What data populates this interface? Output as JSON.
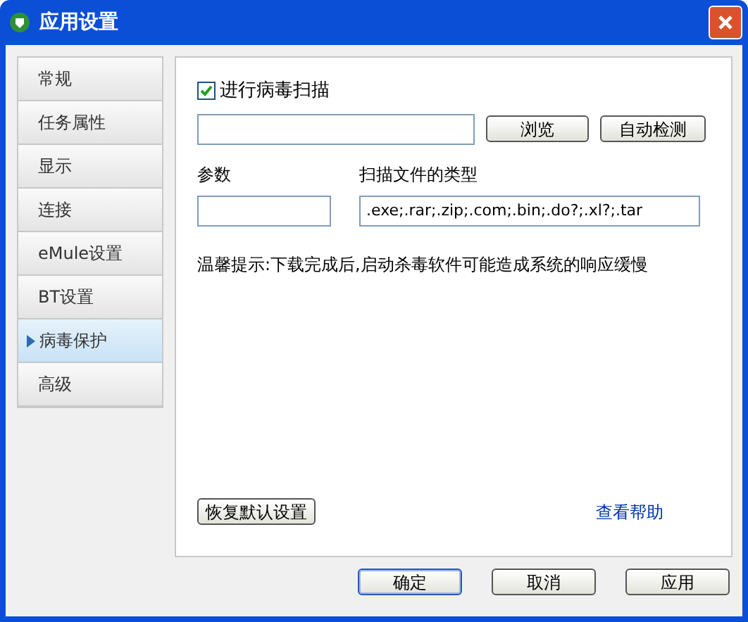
{
  "window": {
    "title": "应用设置"
  },
  "sidebar": {
    "items": [
      {
        "label": "常规",
        "selected": false
      },
      {
        "label": "任务属性",
        "selected": false
      },
      {
        "label": "显示",
        "selected": false
      },
      {
        "label": "连接",
        "selected": false
      },
      {
        "label": "eMule设置",
        "selected": false
      },
      {
        "label": "BT设置",
        "selected": false
      },
      {
        "label": "病毒保护",
        "selected": true
      },
      {
        "label": "高级",
        "selected": false
      }
    ]
  },
  "scan_checkbox": {
    "label": "进行病毒扫描",
    "checked": true
  },
  "path_buttons": [
    "浏览",
    "自动检测"
  ],
  "params": {
    "label": "参数"
  },
  "file_types": {
    "label": "扫描文件的类型",
    "value": ".exe;.rar;.zip;.com;.bin;.do?;.xl?;.tar"
  },
  "hint": "温馨提示:下载完成后,启动杀毒软件可能造成系统的响应缓慢",
  "restore_button": "恢复默认设置",
  "help_link": "查看帮助",
  "footer_buttons": [
    {
      "label": "确定",
      "default": true
    },
    {
      "label": "取消",
      "default": false
    },
    {
      "label": "应用",
      "default": false
    }
  ]
}
